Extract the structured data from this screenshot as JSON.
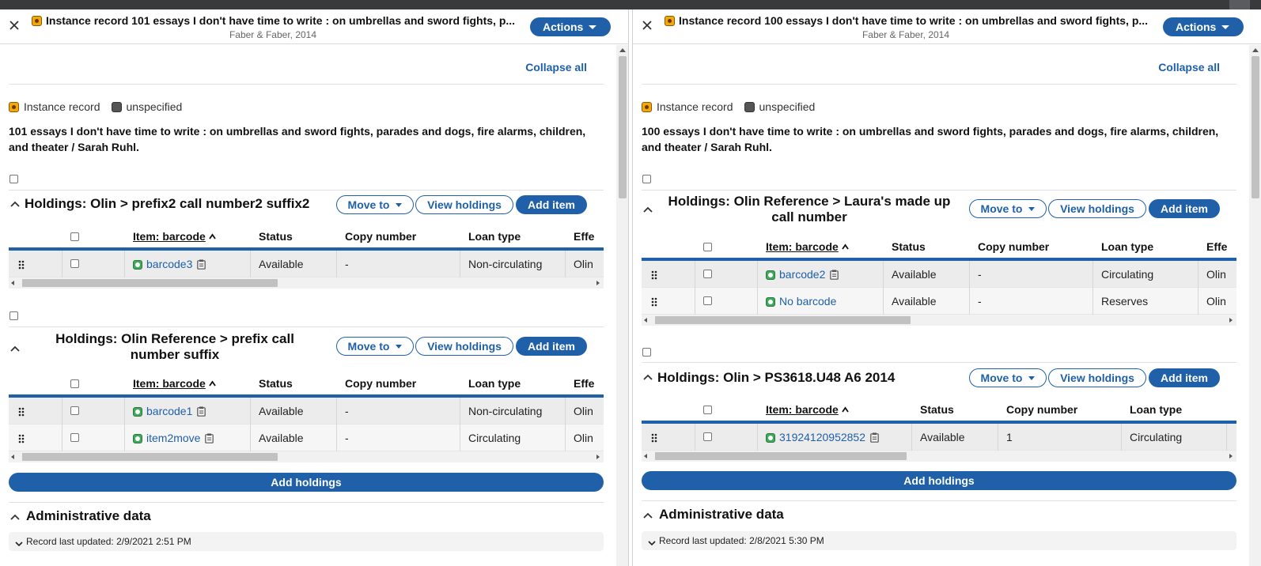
{
  "panes": [
    {
      "header": {
        "title": "Instance record 101 essays I don't have time to write : on umbrellas and sword fights, p...",
        "subtitle": "Faber & Faber, 2014",
        "actions_label": "Actions"
      },
      "collapse_all_label": "Collapse all",
      "badges": {
        "record_type": "Instance record",
        "status": "unspecified"
      },
      "instance_title": "101 essays I don't have time to write : on umbrellas and sword fights, parades and dogs, fire alarms, children, and theater / Sarah Ruhl.",
      "holdings": [
        {
          "title": "Holdings: Olin > prefix2 call number2 suffix2",
          "move_to_label": "Move to",
          "view_holdings_label": "View holdings",
          "add_item_label": "Add item",
          "columns": [
            "Item: barcode",
            "Status",
            "Copy number",
            "Loan type",
            "Effe"
          ],
          "rows": [
            {
              "barcode": "barcode3",
              "status": "Available",
              "copy_number": "-",
              "loan_type": "Non-circulating",
              "effective": "Olin"
            }
          ]
        },
        {
          "title": "Holdings: Olin Reference > prefix call number suffix",
          "move_to_label": "Move to",
          "view_holdings_label": "View holdings",
          "add_item_label": "Add item",
          "columns": [
            "Item: barcode",
            "Status",
            "Copy number",
            "Loan type",
            "Effe"
          ],
          "rows": [
            {
              "barcode": "barcode1",
              "status": "Available",
              "copy_number": "-",
              "loan_type": "Non-circulating",
              "effective": "Olin"
            },
            {
              "barcode": "item2move",
              "status": "Available",
              "copy_number": "-",
              "loan_type": "Circulating",
              "effective": "Olin"
            }
          ]
        }
      ],
      "add_holdings_label": "Add holdings",
      "admin": {
        "title": "Administrative data",
        "last_updated": "Record last updated: 2/9/2021 2:51 PM"
      }
    },
    {
      "header": {
        "title": "Instance record 100 essays I don't have time to write : on umbrellas and sword fights, p...",
        "subtitle": "Faber & Faber, 2014",
        "actions_label": "Actions"
      },
      "collapse_all_label": "Collapse all",
      "badges": {
        "record_type": "Instance record",
        "status": "unspecified"
      },
      "instance_title": "100 essays I don't have time to write : on umbrellas and sword fights, parades and dogs, fire alarms, children, and theater / Sarah Ruhl.",
      "holdings": [
        {
          "title": "Holdings: Olin Reference > Laura's made up call number",
          "move_to_label": "Move to",
          "view_holdings_label": "View holdings",
          "add_item_label": "Add item",
          "columns": [
            "Item: barcode",
            "Status",
            "Copy number",
            "Loan type",
            "Effe"
          ],
          "rows": [
            {
              "barcode": "barcode2",
              "status": "Available",
              "copy_number": "-",
              "loan_type": "Circulating",
              "effective": "Olin"
            },
            {
              "barcode": "No barcode",
              "status": "Available",
              "copy_number": "-",
              "loan_type": "Reserves",
              "effective": "Olin"
            }
          ]
        },
        {
          "title": "Holdings: Olin > PS3618.U48 A6 2014",
          "move_to_label": "Move to",
          "view_holdings_label": "View holdings",
          "add_item_label": "Add item",
          "columns": [
            "Item: barcode",
            "Status",
            "Copy number",
            "Loan type"
          ],
          "rows": [
            {
              "barcode": "31924120952852",
              "status": "Available",
              "copy_number": "1",
              "loan_type": "Circulating"
            }
          ]
        }
      ],
      "add_holdings_label": "Add holdings",
      "admin": {
        "title": "Administrative data",
        "last_updated": "Record last updated: 2/8/2021 5:30 PM"
      }
    }
  ]
}
